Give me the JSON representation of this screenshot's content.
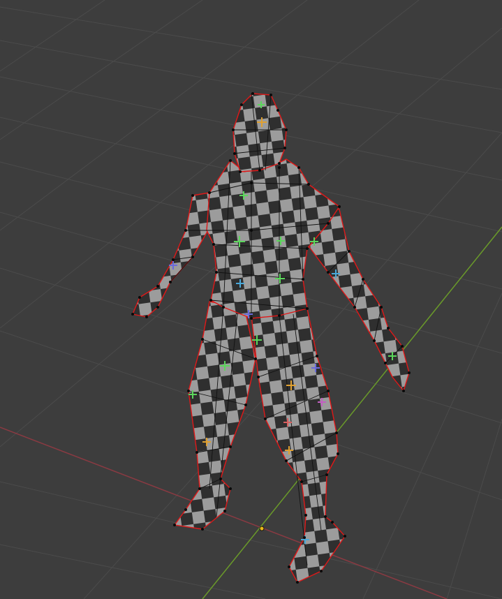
{
  "viewport": {
    "background": "#3d3d3d",
    "grid_color": "#4b4b4b",
    "x_axis_color": "#8a3a42",
    "y_axis_color": "#6a9a2a",
    "origin_color": "#e8b81a"
  },
  "mesh": {
    "checker_light": "#9c9c9c",
    "checker_dark": "#2f2f2f",
    "wire_color": "#111111",
    "seam_color": "#e01818",
    "vertex_color": "#0a0a0a",
    "face_dot_colors": [
      "#5cd65c",
      "#e0a030",
      "#6a6adc",
      "#c25fc2",
      "#4aa8d8",
      "#d86060"
    ]
  }
}
